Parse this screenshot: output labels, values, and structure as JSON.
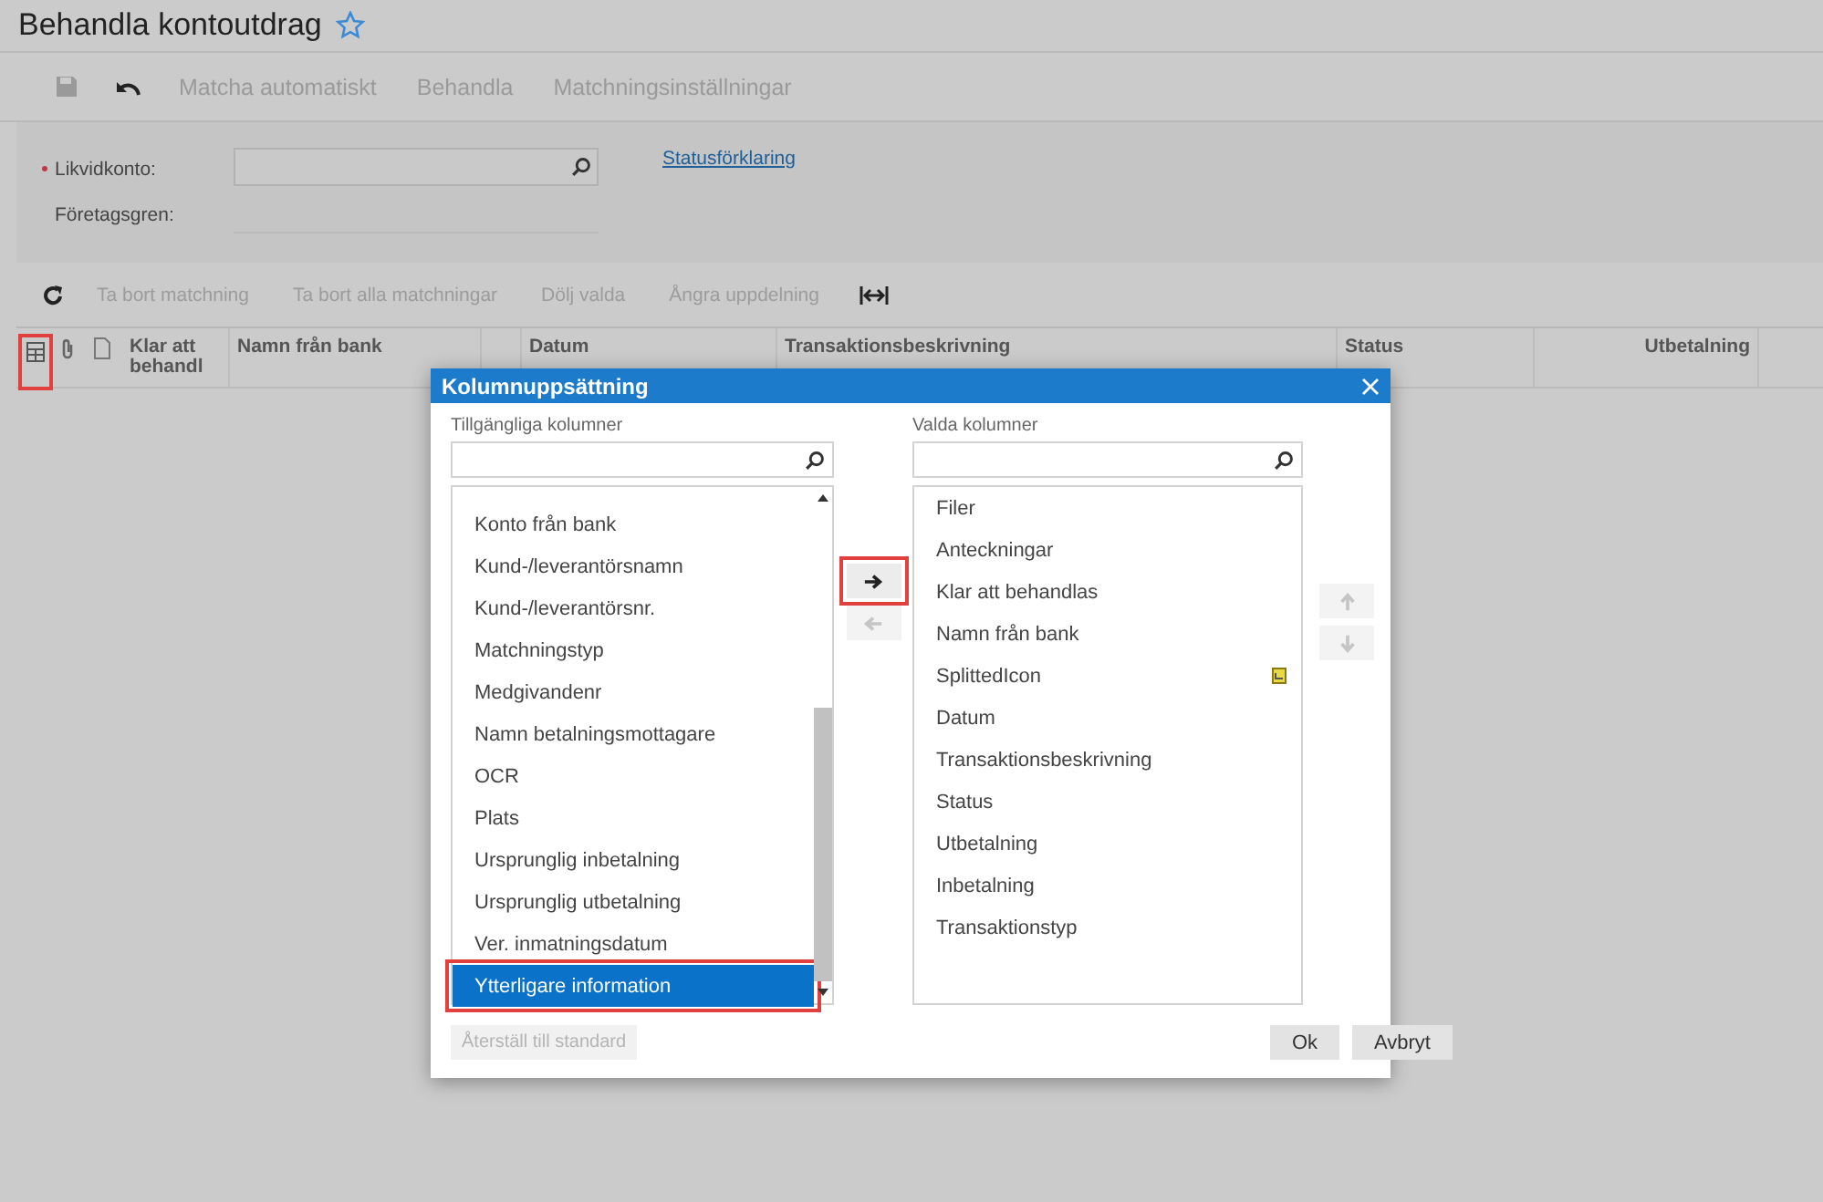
{
  "page": {
    "title": "Behandla kontoutdrag",
    "favorite": false
  },
  "toolbar": {
    "actions": [
      "Matcha automatiskt",
      "Behandla",
      "Matchningsinställningar"
    ]
  },
  "form": {
    "fields": [
      {
        "label": "Likvidkonto:",
        "required": true,
        "kind": "lookup"
      },
      {
        "label": "Företagsgren:",
        "required": false,
        "kind": "text"
      }
    ],
    "link": "Statusförklaring"
  },
  "grid_toolbar": {
    "actions": [
      "Ta bort matchning",
      "Ta bort alla matchningar",
      "Dölj valda",
      "Ångra uppdelning"
    ]
  },
  "grid": {
    "columns": [
      {
        "kind": "config",
        "highlighted": true
      },
      {
        "kind": "attach"
      },
      {
        "kind": "note"
      },
      {
        "kind": "text",
        "label": "Klar att behandl"
      },
      {
        "kind": "text",
        "label": "Namn från bank"
      },
      {
        "kind": "blank"
      },
      {
        "kind": "text",
        "label": "Datum"
      },
      {
        "kind": "text",
        "label": "Transaktionsbeskrivning"
      },
      {
        "kind": "text",
        "label": "Status"
      },
      {
        "kind": "number",
        "label": "Utbetalning"
      },
      {
        "kind": "blank"
      }
    ]
  },
  "dialog": {
    "title": "Kolumnuppsättning",
    "available": {
      "label": "Tillgängliga kolumner",
      "items": [
        {
          "label": "Konto från bank",
          "selected": false
        },
        {
          "label": "Kund-/leverantörsnamn",
          "selected": false
        },
        {
          "label": "Kund-/leverantörsnr.",
          "selected": false
        },
        {
          "label": "Matchningstyp",
          "selected": false
        },
        {
          "label": "Medgivandenr",
          "selected": false
        },
        {
          "label": "Namn betalningsmottagare",
          "selected": false
        },
        {
          "label": "OCR",
          "selected": false
        },
        {
          "label": "Plats",
          "selected": false
        },
        {
          "label": "Ursprunglig inbetalning",
          "selected": false
        },
        {
          "label": "Ursprunglig utbetalning",
          "selected": false
        },
        {
          "label": "Ver. inmatningsdatum",
          "selected": false
        },
        {
          "label": "Ytterligare information",
          "selected": true,
          "highlighted": true
        }
      ]
    },
    "move_buttons": [
      {
        "kind": "right",
        "disabled": false,
        "highlighted": true
      },
      {
        "kind": "left",
        "disabled": true,
        "highlighted": false
      }
    ],
    "chosen": {
      "label": "Valda kolumner",
      "items": [
        {
          "label": "Filer",
          "selected": false,
          "icon": false
        },
        {
          "label": "Anteckningar",
          "selected": false,
          "icon": false
        },
        {
          "label": "Klar att behandlas",
          "selected": false,
          "icon": false
        },
        {
          "label": "Namn från bank",
          "selected": false,
          "icon": false
        },
        {
          "label": "SplittedIcon",
          "selected": false,
          "icon": true
        },
        {
          "label": "Datum",
          "selected": false,
          "icon": false
        },
        {
          "label": "Transaktionsbeskrivning",
          "selected": false,
          "icon": false
        },
        {
          "label": "Status",
          "selected": false,
          "icon": false
        },
        {
          "label": "Utbetalning",
          "selected": false,
          "icon": false
        },
        {
          "label": "Inbetalning",
          "selected": false,
          "icon": false
        },
        {
          "label": "Transaktionstyp",
          "selected": false,
          "icon": false
        }
      ]
    },
    "order_buttons": [
      {
        "kind": "up",
        "disabled": true
      },
      {
        "kind": "down",
        "disabled": true
      }
    ],
    "reset_button": {
      "label": "Återställ till standard",
      "disabled": true
    },
    "buttons": [
      "Ok",
      "Avbryt"
    ]
  }
}
